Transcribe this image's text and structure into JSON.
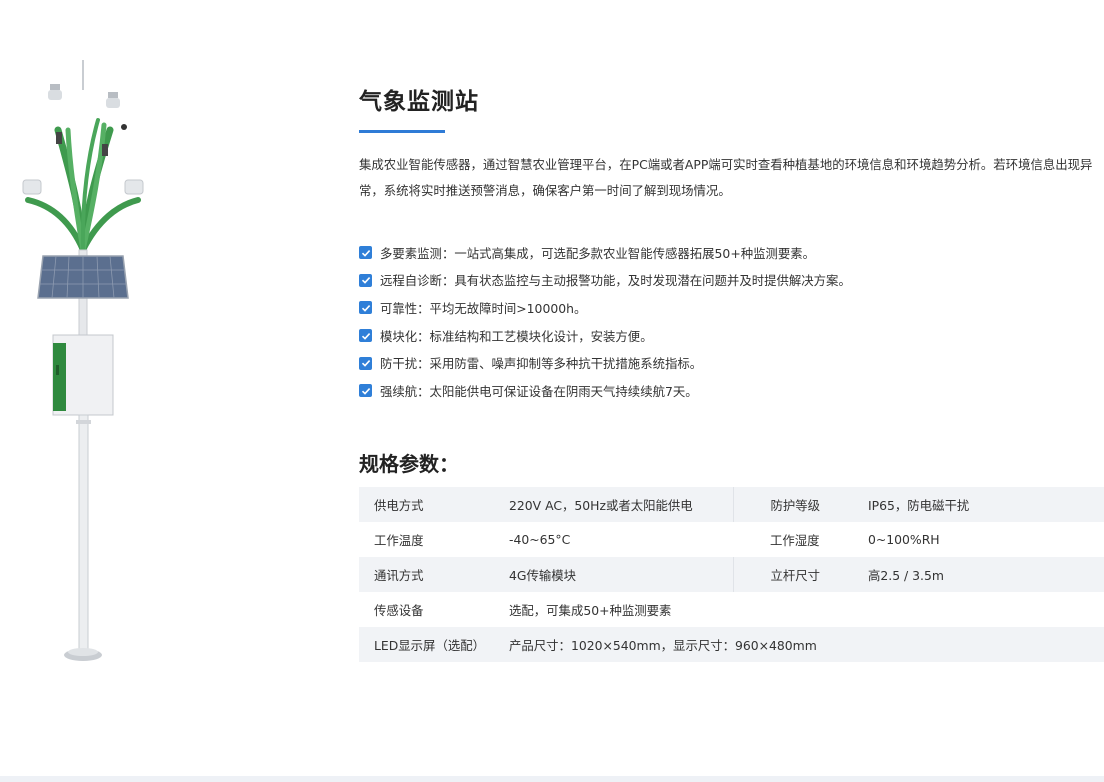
{
  "product": {
    "title": "气象监测站",
    "intro": "集成农业智能传感器，通过智慧农业管理平台，在PC端或者APP端可实时查看种植基地的环境信息和环境趋势分析。若环境信息出现异常，系统将实时推送预警消息，确保客户第一时间了解到现场情况。",
    "image_alt": "气象监测站"
  },
  "features": [
    "多要素监测：一站式高集成，可选配多款农业智能传感器拓展50+种监测要素。",
    "远程自诊断：具有状态监控与主动报警功能，及时发现潜在问题并及时提供解决方案。",
    "可靠性：平均无故障时间>10000h。",
    "模块化：标准结构和工艺模块化设计，安装方便。",
    "防干扰：采用防雷、噪声抑制等多种抗干扰措施系统指标。",
    "强续航：太阳能供电可保证设备在阴雨天气持续续航7天。"
  ],
  "specs": {
    "title": "规格参数：",
    "rows": [
      {
        "k1": "供电方式",
        "v1": "220V AC，50Hz或者太阳能供电",
        "k2": "防护等级",
        "v2": "IP65，防电磁干扰"
      },
      {
        "k1": "工作温度",
        "v1": "-40~65°C",
        "k2": "工作湿度",
        "v2": "0~100%RH"
      },
      {
        "k1": "通讯方式",
        "v1": "4G传输模块",
        "k2": "立杆尺寸",
        "v2": "高2.5 / 3.5m"
      },
      {
        "k1": "传感设备",
        "v1": "选配，可集成50+种监测要素"
      },
      {
        "k1": "LED显示屏（选配）",
        "v1": "产品尺寸：1020×540mm，显示尺寸：960×480mm"
      }
    ]
  },
  "colors": {
    "accent": "#2e7bd6",
    "check": "#2f7fd8",
    "pole_green": "#3f9a4e",
    "row_shade": "#f1f3f6"
  },
  "icons": {
    "check": "checkbox-checked-icon"
  }
}
